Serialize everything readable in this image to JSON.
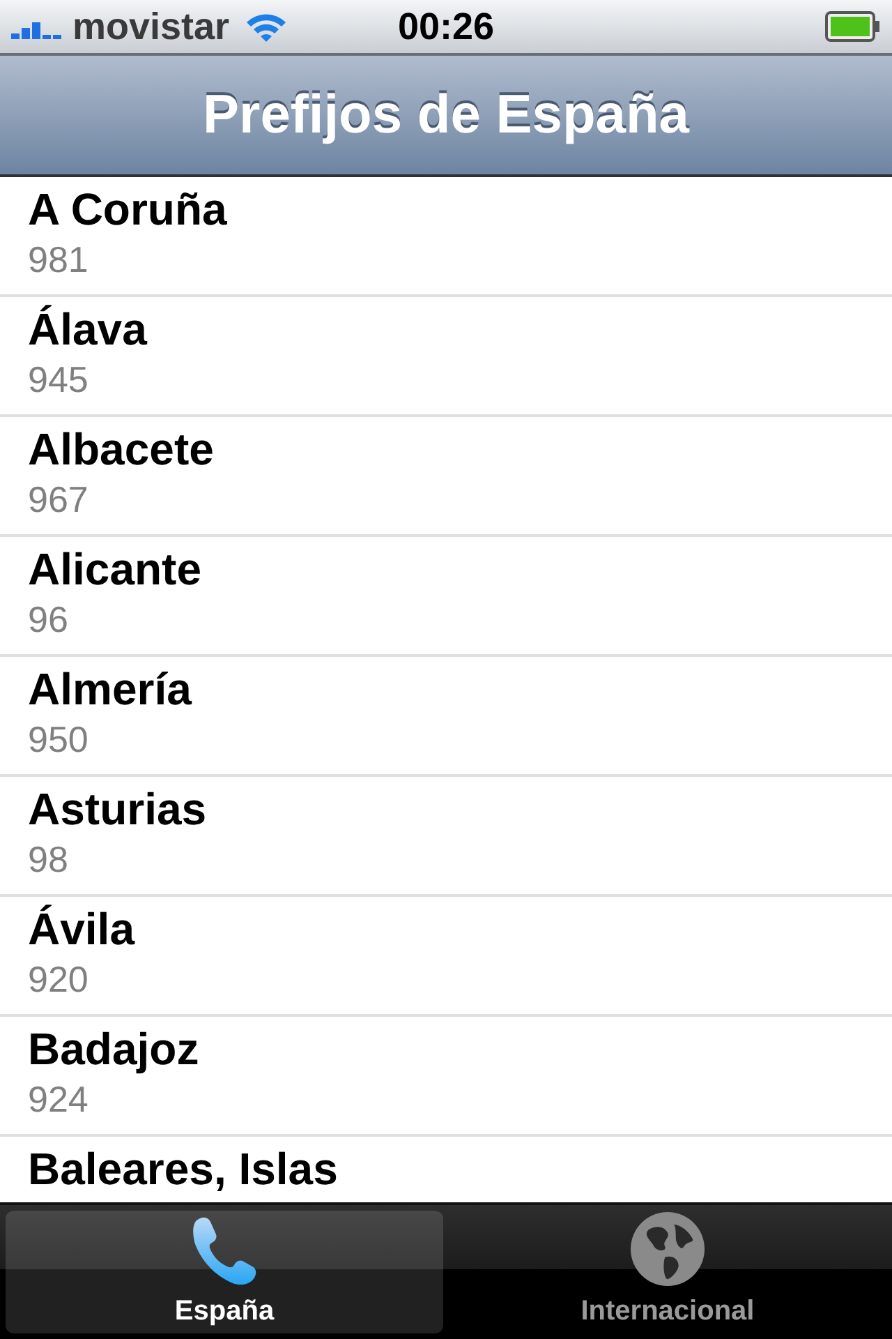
{
  "status_bar": {
    "carrier": "movistar",
    "time": "00:26"
  },
  "nav_bar": {
    "title": "Prefijos de España"
  },
  "list": [
    {
      "name": "A Coruña",
      "code": "981"
    },
    {
      "name": "Álava",
      "code": "945"
    },
    {
      "name": "Albacete",
      "code": "967"
    },
    {
      "name": "Alicante",
      "code": "96"
    },
    {
      "name": "Almería",
      "code": "950"
    },
    {
      "name": "Asturias",
      "code": "98"
    },
    {
      "name": "Ávila",
      "code": "920"
    },
    {
      "name": "Badajoz",
      "code": "924"
    },
    {
      "name": "Baleares, Islas"
    }
  ],
  "tab_bar": [
    {
      "label": "España",
      "kind": "phone",
      "selected": true
    },
    {
      "label": "Internacional",
      "kind": "globe",
      "selected": false
    }
  ]
}
